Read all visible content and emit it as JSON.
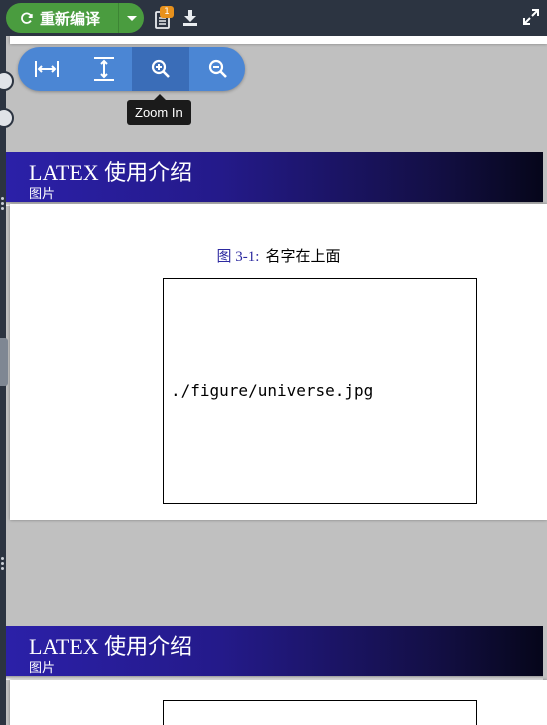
{
  "toolbar": {
    "recompile_label": "重新编译",
    "logs_badge": "1"
  },
  "zoom": {
    "tooltip": "Zoom In"
  },
  "slides": [
    {
      "header_title": "LATEX 使用介绍",
      "header_subtitle": "图片",
      "caption_label": "图 3-1:",
      "caption_text": "名字在上面",
      "figure_path": "./figure/universe.jpg"
    },
    {
      "header_title": "LATEX 使用介绍",
      "header_subtitle": "图片"
    }
  ],
  "icons": {
    "recompile": "refresh-icon",
    "dropdown": "caret-down-icon",
    "logs": "document-icon",
    "download": "download-icon",
    "fullscreen": "expand-icon",
    "fit_width": "fit-width-icon",
    "fit_height": "fit-height-icon",
    "zoom_in": "zoom-in-icon",
    "zoom_out": "zoom-out-icon"
  },
  "colors": {
    "recompile_button": "#4a9c3f",
    "zoom_bar": "#4b86d4",
    "header_gradient_start": "#2b20a8",
    "header_gradient_end": "#06061a",
    "badge": "#e8911c",
    "caption_label": "#2d2aa0"
  }
}
